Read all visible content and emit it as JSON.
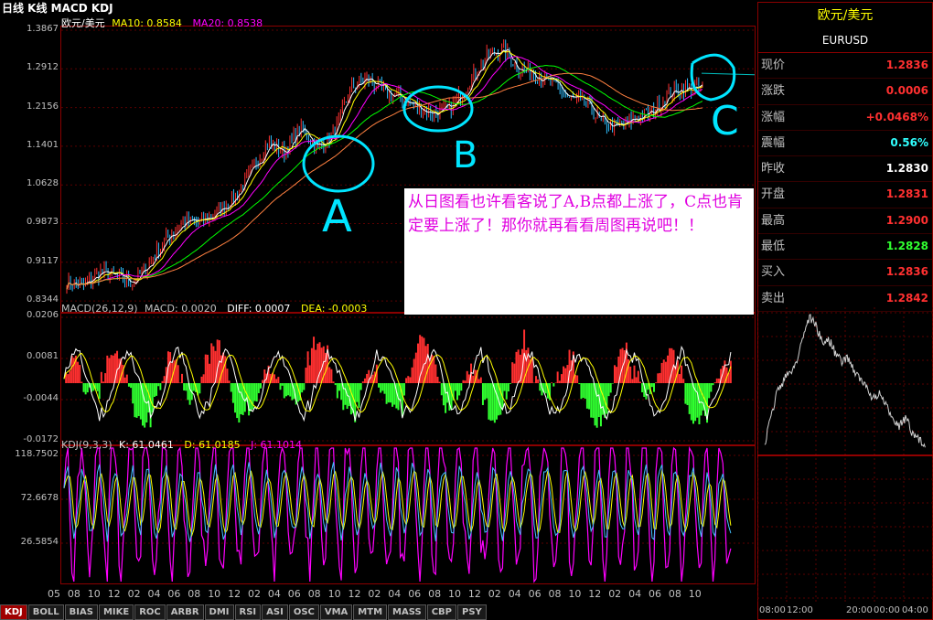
{
  "title": "日线 K线 MACD KDJ",
  "price_pane": {
    "legend": {
      "symbol": "欧元/美元",
      "ma10": "MA10: 0.8584",
      "ma20": "MA20: 0.8538"
    },
    "y_ticks": [
      "1.3867",
      "1.2912",
      "1.2156",
      "1.1401",
      "1.0628",
      "0.9873",
      "0.9117",
      "0.8344"
    ]
  },
  "macd_pane": {
    "legend": {
      "name": "MACD(26,12,9)",
      "macd": "MACD: 0.0020",
      "diff": "DIFF: 0.0007",
      "dea": "DEA: -0.0003"
    },
    "y_ticks": [
      "0.0206",
      "0.0081",
      "-0.0044",
      "-0.0172"
    ]
  },
  "kdj_pane": {
    "legend": {
      "name": "KDJ(9,3,3)",
      "k": "K: 61.0461",
      "d": "D: 61.0185",
      "j": "J: 61.1014"
    },
    "y_ticks": [
      "118.7502",
      "72.6678",
      "26.5854"
    ]
  },
  "x_axis": [
    "05",
    "08",
    "10",
    "12",
    "02",
    "04",
    "06",
    "08",
    "10",
    "12",
    "02",
    "04",
    "06",
    "08",
    "10",
    "12",
    "02",
    "04",
    "06",
    "08",
    "10",
    "12",
    "02",
    "04",
    "06",
    "08",
    "10",
    "12",
    "02",
    "04",
    "06",
    "08",
    "10"
  ],
  "tabs": [
    "KDJ",
    "BOLL",
    "BIAS",
    "MIKE",
    "ROC",
    "ARBR",
    "DMI",
    "RSI",
    "ASI",
    "OSC",
    "VMA",
    "MTM",
    "MASS",
    "CBP",
    "PSY"
  ],
  "active_tab": "KDJ",
  "annotations": {
    "a": "A",
    "b": "B",
    "c": "C"
  },
  "note": "从日图看也许看客说了A,B点都上涨了，C点也肯定要上涨了！那你就再看看周图再说吧！！",
  "side": {
    "name": "欧元/美元",
    "code": "EURUSD",
    "quotes": [
      {
        "label": "现价",
        "value": "1.2836",
        "color": "#ff3030"
      },
      {
        "label": "涨跌",
        "value": "0.0006",
        "color": "#ff3030"
      },
      {
        "label": "涨幅",
        "value": "+0.0468%",
        "color": "#ff3030"
      },
      {
        "label": "震幅",
        "value": "0.56%",
        "color": "#30ffff"
      },
      {
        "label": "昨收",
        "value": "1.2830",
        "color": "#ffffff"
      },
      {
        "label": "开盘",
        "value": "1.2831",
        "color": "#ff3030"
      },
      {
        "label": "最高",
        "value": "1.2900",
        "color": "#ff3030"
      },
      {
        "label": "最低",
        "value": "1.2828",
        "color": "#30ff30"
      },
      {
        "label": "买入",
        "value": "1.2836",
        "color": "#ff3030"
      },
      {
        "label": "卖出",
        "value": "1.2842",
        "color": "#ff3030"
      }
    ],
    "time_labels": [
      "08:00",
      "12:00",
      "20:00",
      "00:00",
      "04:00"
    ]
  }
}
